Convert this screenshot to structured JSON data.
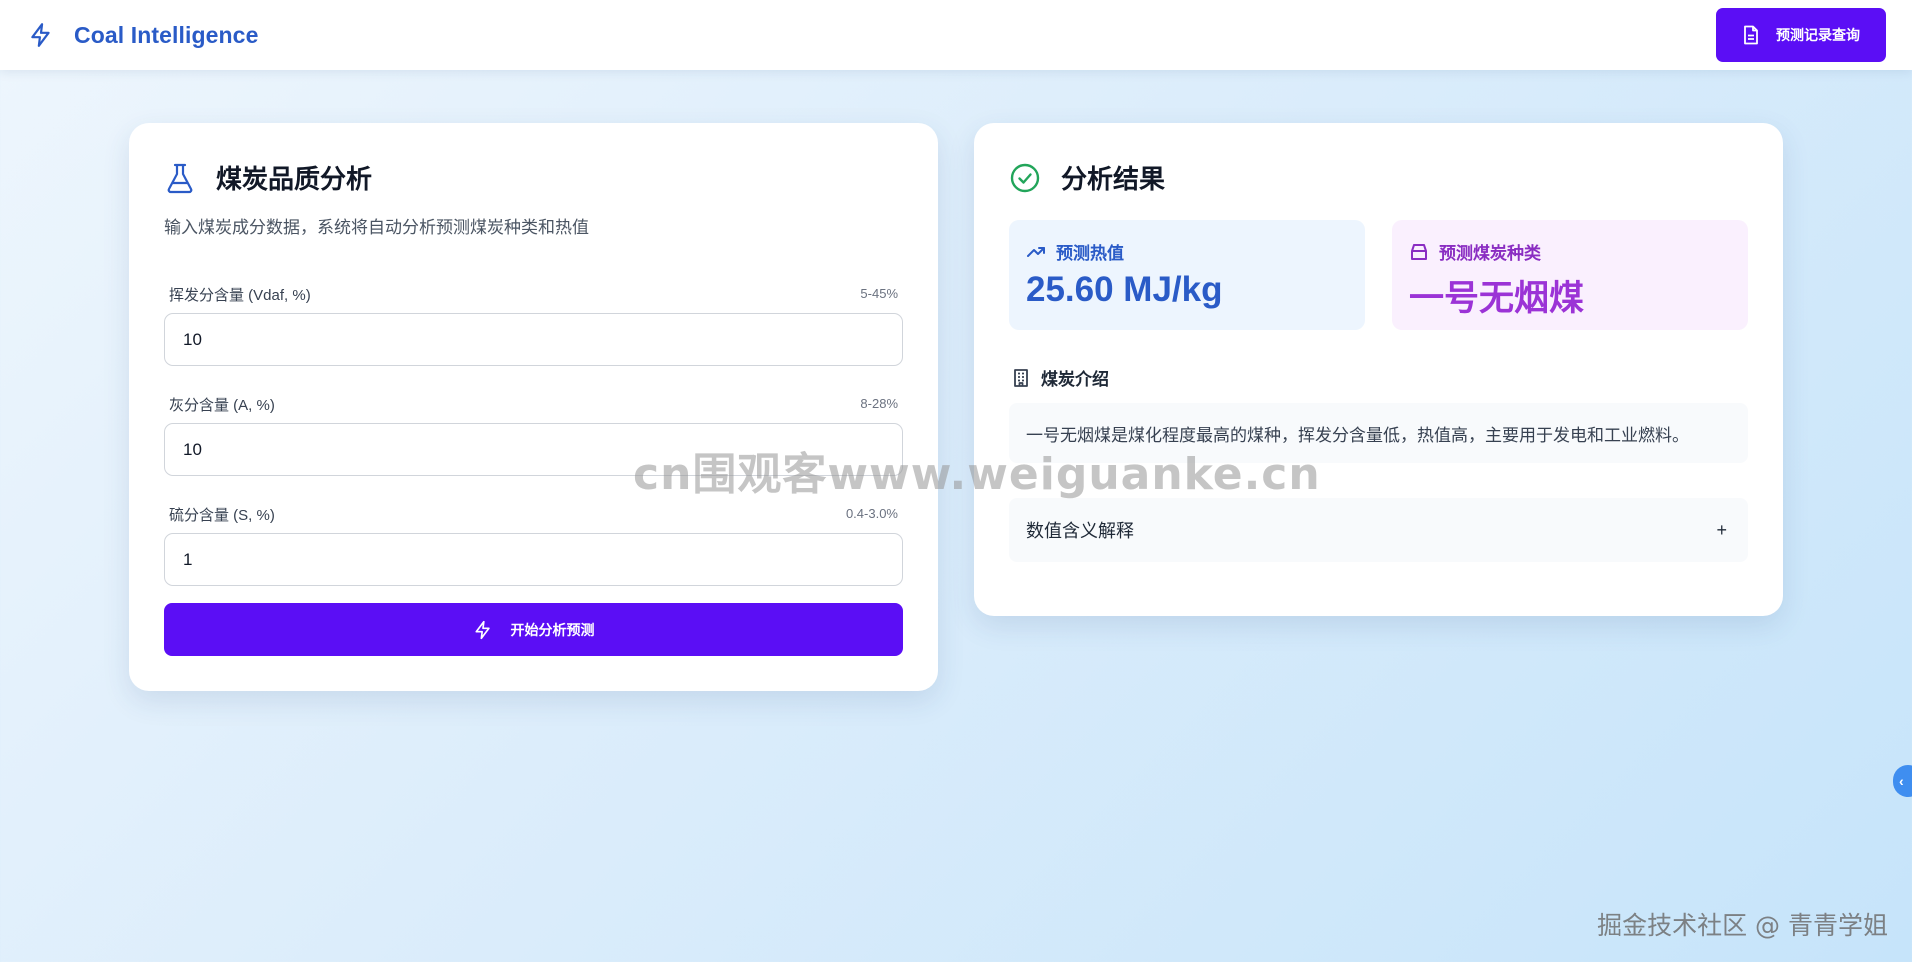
{
  "header": {
    "brand_name": "Coal Intelligence",
    "history_button_label": "预测记录查询"
  },
  "input_card": {
    "title": "煤炭品质分析",
    "subtitle": "输入煤炭成分数据，系统将自动分析预测煤炭种类和热值",
    "fields": [
      {
        "label": "挥发分含量 (Vdaf, %)",
        "range": "5-45%",
        "value": "10"
      },
      {
        "label": "灰分含量 (A, %)",
        "range": "8-28%",
        "value": "10"
      },
      {
        "label": "硫分含量 (S, %)",
        "range": "0.4-3.0%",
        "value": "1"
      }
    ],
    "submit_label": "开始分析预测"
  },
  "result_card": {
    "title": "分析结果",
    "heat_label": "预测热值",
    "heat_value": "25.60 MJ/kg",
    "type_label": "预测煤炭种类",
    "type_value": "一号无烟煤",
    "intro_title": "煤炭介绍",
    "intro_text": "一号无烟煤是煤化程度最高的煤种，挥发分含量低，热值高，主要用于发电和工业燃料。",
    "explain_label": "数值含义解释",
    "explain_toggle": "+"
  },
  "watermarks": {
    "center": "cn围观客www.weiguanke.cn",
    "corner": "掘金技术社区 @ 青青学姐"
  },
  "edge_tab": {
    "glyph": "‹"
  },
  "colors": {
    "accent_purple": "#5b0ef5",
    "brand_blue": "#2a5bc7",
    "type_purple": "#9b33d6",
    "success_green": "#22a55a"
  }
}
